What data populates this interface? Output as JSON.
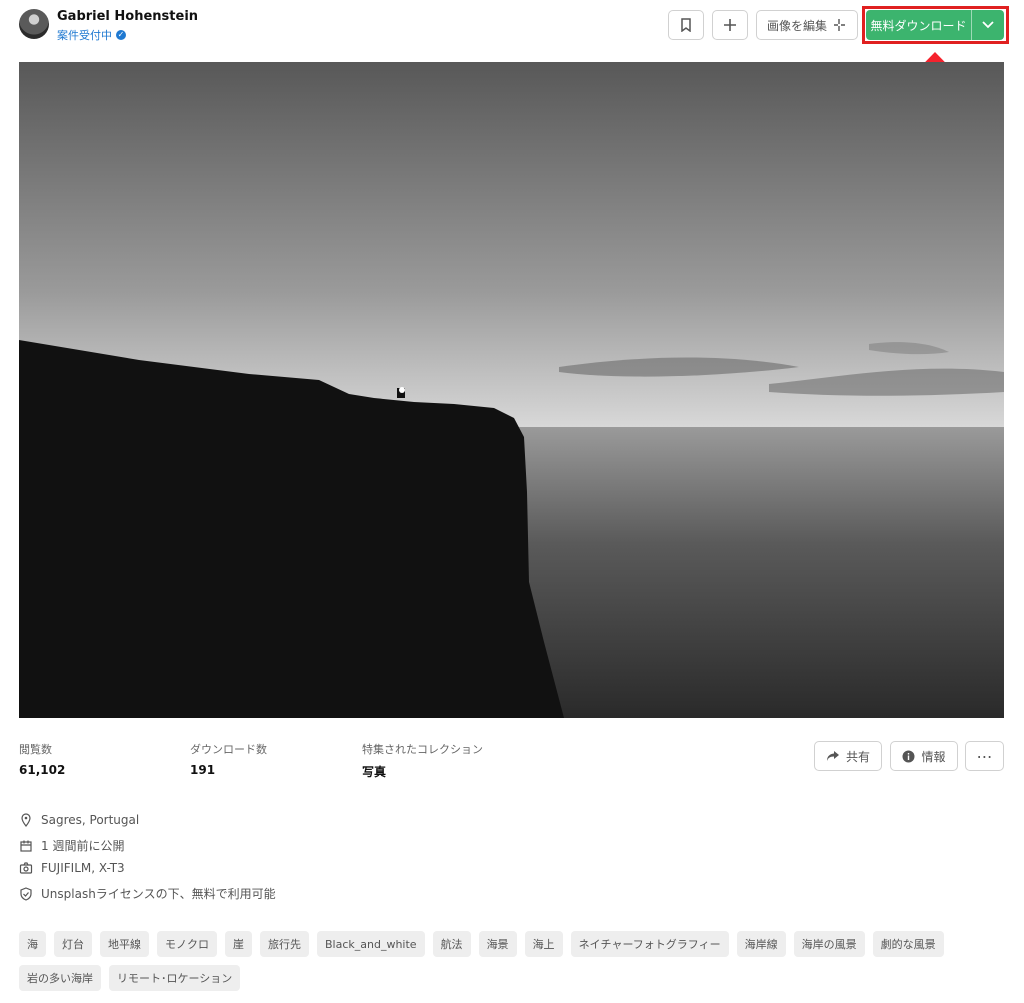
{
  "author": {
    "name": "Gabriel Hohenstein",
    "status": "案件受付中"
  },
  "toolbar": {
    "edit_image_label": "画像を編集",
    "download_label": "無料ダウンロード"
  },
  "stats": [
    {
      "label": "閲覧数",
      "value": "61,102"
    },
    {
      "label": "ダウンロード数",
      "value": "191"
    },
    {
      "label": "特集されたコレクション",
      "value": "写真"
    }
  ],
  "actions": {
    "share_label": "共有",
    "info_label": "情報",
    "more_label": "⋯"
  },
  "details": {
    "location": "Sagres, Portugal",
    "published": "1 週間前に公開",
    "camera": "FUJIFILM, X-T3",
    "license": "Unsplashライセンスの下、無料で利用可能"
  },
  "tags": [
    "海",
    "灯台",
    "地平線",
    "モノクロ",
    "崖",
    "旅行先",
    "Black_and_white",
    "航法",
    "海景",
    "海上",
    "ネイチャーフォトグラフィー",
    "海岸線",
    "海岸の風景",
    "劇的な風景",
    "岩の多い海岸",
    "リモート･ロケーション"
  ],
  "colors": {
    "download_green": "#3cb46e",
    "highlight_red": "#e02020",
    "verified_blue": "#1f79d1"
  }
}
